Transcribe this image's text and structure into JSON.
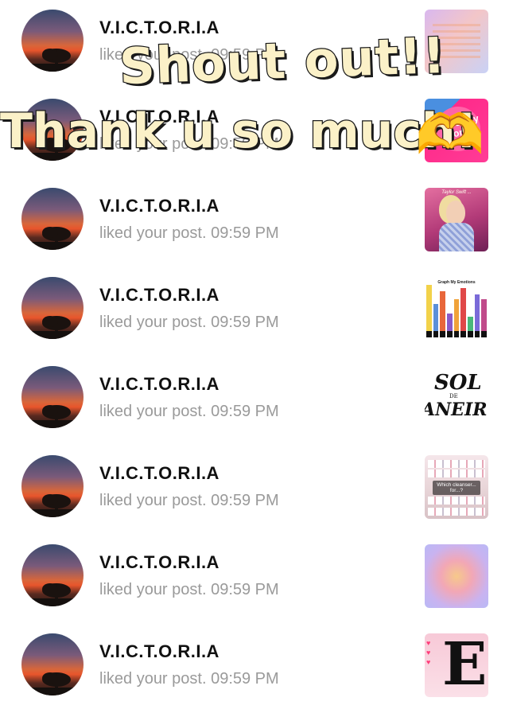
{
  "notifications": [
    {
      "name": "V.I.C.T.O.R.I.A",
      "action": "liked your post. 09:59 PM",
      "thumb": "pastel-collage"
    },
    {
      "name": "V.I.C.T.O.R.I.A",
      "action": "liked your post. 09:59 PM",
      "thumb": "pink-body-text"
    },
    {
      "name": "V.I.C.T.O.R.I.A",
      "action": "liked your post. 09:59 PM",
      "thumb": "concert-photo"
    },
    {
      "name": "V.I.C.T.O.R.I.A",
      "action": "liked your post. 09:59 PM",
      "thumb": "graph-chart"
    },
    {
      "name": "V.I.C.T.O.R.I.A",
      "action": "liked your post. 09:59 PM",
      "thumb": "sol-de-janeiro-logo"
    },
    {
      "name": "V.I.C.T.O.R.I.A",
      "action": "liked your post. 09:59 PM",
      "thumb": "makeup-store"
    },
    {
      "name": "V.I.C.T.O.R.I.A",
      "action": "liked your post. 09:59 PM",
      "thumb": "aura-gradient"
    },
    {
      "name": "V.I.C.T.O.R.I.A",
      "action": "liked your post. 09:59 PM",
      "thumb": "letter-e-pink"
    }
  ],
  "thumbs": {
    "pink_text": "Sun Body Works",
    "singer_caption": "Taylor Swift ...",
    "graph_title": "Graph My Emotions",
    "sol": "SOL",
    "de": "DE",
    "janeiro": "ANEIR",
    "makeup_caption": "Which cleanser... for...?",
    "e_letter": "E"
  },
  "overlay": {
    "shout": "Shout out!!",
    "thank": "Thank u so much!",
    "emoji": "🫶"
  },
  "colors": {
    "name": "#111111",
    "subtext": "#9a9a9a",
    "sticker_fill": "#fbf1c8",
    "sticker_stroke": "#1a1a1a"
  }
}
